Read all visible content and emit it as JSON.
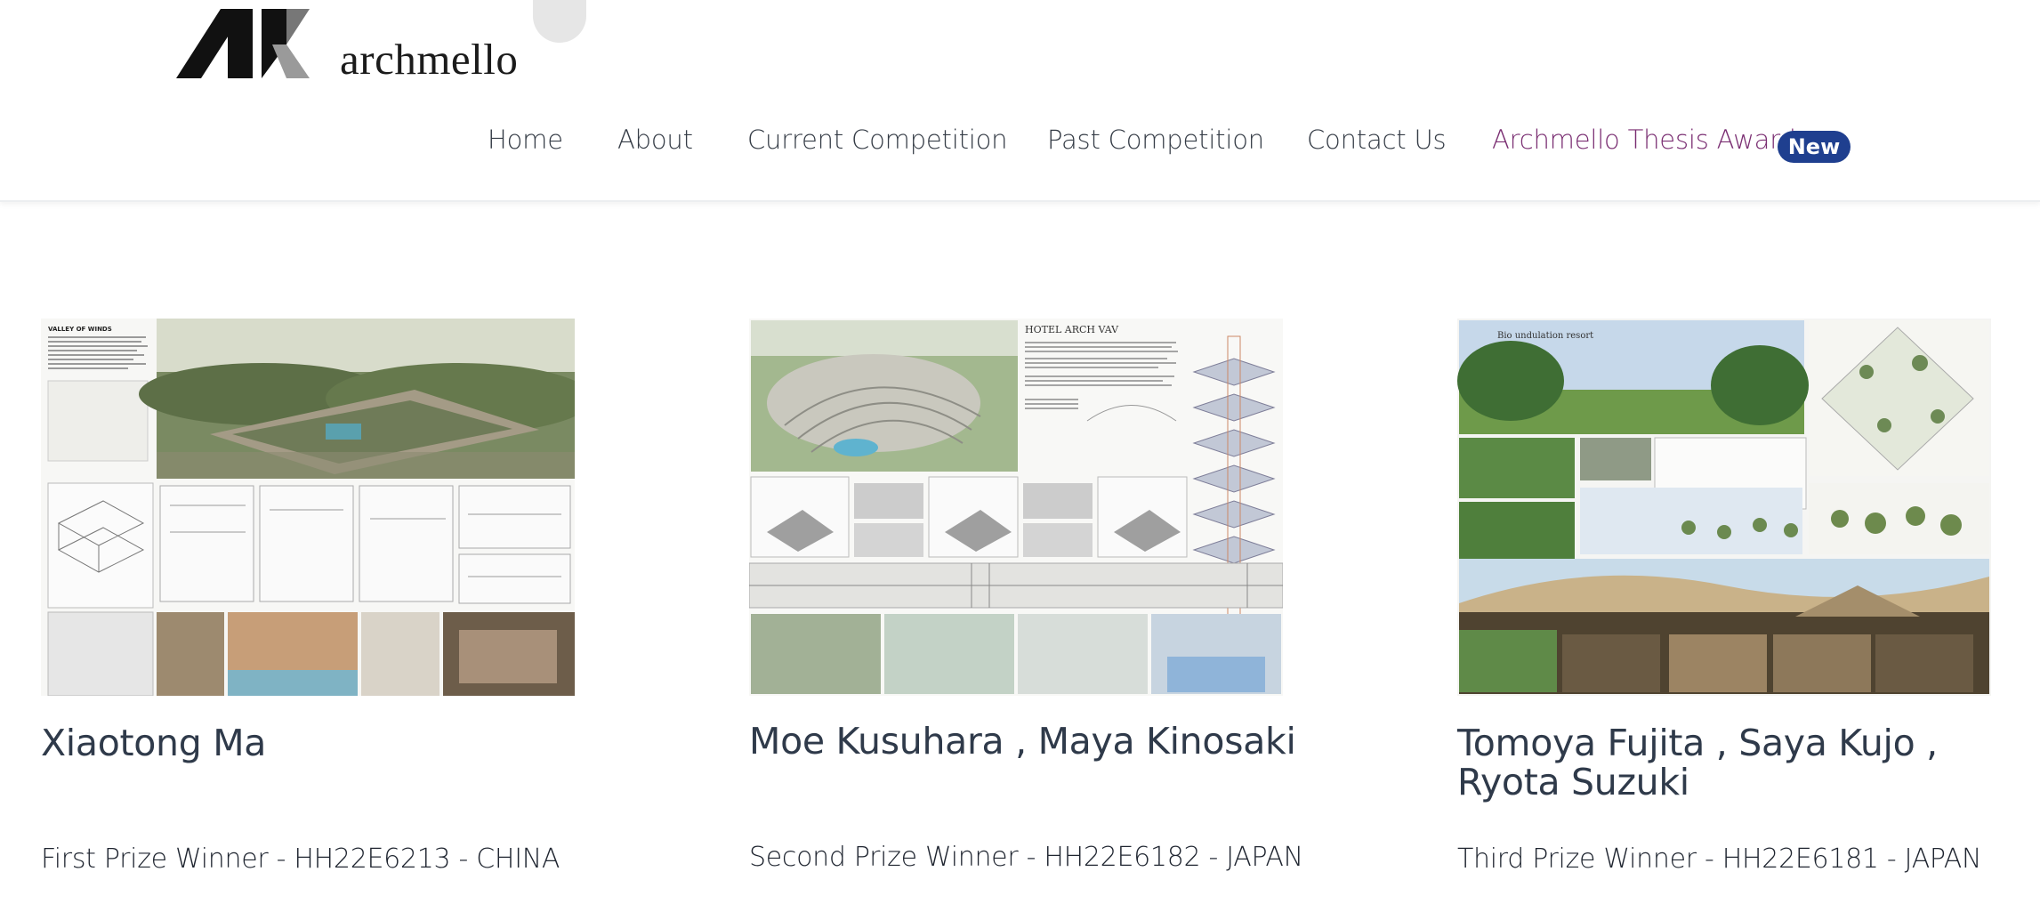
{
  "brand": {
    "logo_text": "archmello"
  },
  "nav": {
    "items": [
      "Home",
      "About",
      "Current Competition",
      "Past Competition",
      "Contact Us",
      "Archmello Thesis Award"
    ],
    "badge": "New"
  },
  "winners": [
    {
      "name": "Xiaotong Ma",
      "prize": "First Prize Winner - HH22E6213 - CHINA",
      "board_title": "VALLEY OF WINDS"
    },
    {
      "name": "Moe Kusuhara , Maya Kinosaki",
      "prize": "Second Prize Winner - HH22E6182 - JAPAN",
      "board_title": "HOTEL ARCH VAV"
    },
    {
      "name": "Tomoya Fujita , Saya Kujo , Ryota Suzuki",
      "prize": "Third Prize Winner - HH22E6181 - JAPAN",
      "board_title": "Bio undulation resort"
    }
  ],
  "colors": {
    "accent_purple": "#7a2e72",
    "badge_blue": "#1f3f8f",
    "nav_text": "#353c46"
  }
}
